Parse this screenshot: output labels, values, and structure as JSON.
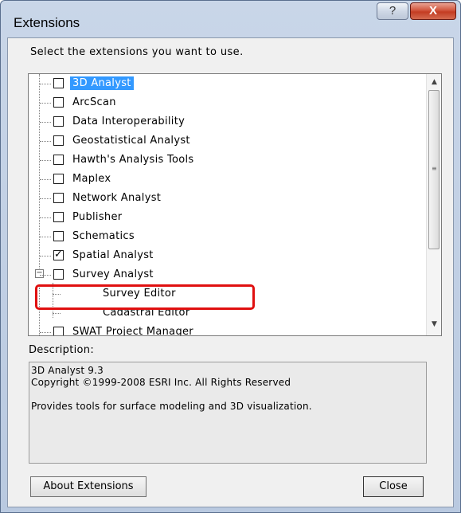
{
  "window": {
    "title": "Extensions",
    "help_glyph": "?",
    "close_glyph": "X"
  },
  "prompt": "Select the extensions you want to use.",
  "extensions": [
    {
      "label": "3D Analyst",
      "checked": false,
      "selected": true
    },
    {
      "label": "ArcScan",
      "checked": false
    },
    {
      "label": "Data Interoperability",
      "checked": false
    },
    {
      "label": "Geostatistical Analyst",
      "checked": false
    },
    {
      "label": "Hawth's Analysis Tools",
      "checked": false
    },
    {
      "label": "Maplex",
      "checked": false
    },
    {
      "label": "Network Analyst",
      "checked": false
    },
    {
      "label": "Publisher",
      "checked": false
    },
    {
      "label": "Schematics",
      "checked": false
    },
    {
      "label": "Spatial Analyst",
      "checked": true
    },
    {
      "label": "Survey Analyst",
      "checked": false,
      "expander": "−"
    },
    {
      "label": "Survey Editor",
      "child": true
    },
    {
      "label": "Cadastral Editor",
      "child": true
    },
    {
      "label": "SWAT Project Manager",
      "checked": false
    }
  ],
  "scrollbar": {
    "up_glyph": "▲",
    "down_glyph": "▼",
    "grip_glyph": "≡"
  },
  "description": {
    "label": "Description:",
    "lines": [
      "3D Analyst 9.3",
      "Copyright ©1999-2008 ESRI Inc. All Rights Reserved",
      "",
      "Provides tools for surface modeling and 3D visualization."
    ]
  },
  "buttons": {
    "about": "About Extensions",
    "close": "Close"
  },
  "colors": {
    "selection": "#3399ff",
    "highlight_annotation": "#e01010"
  }
}
